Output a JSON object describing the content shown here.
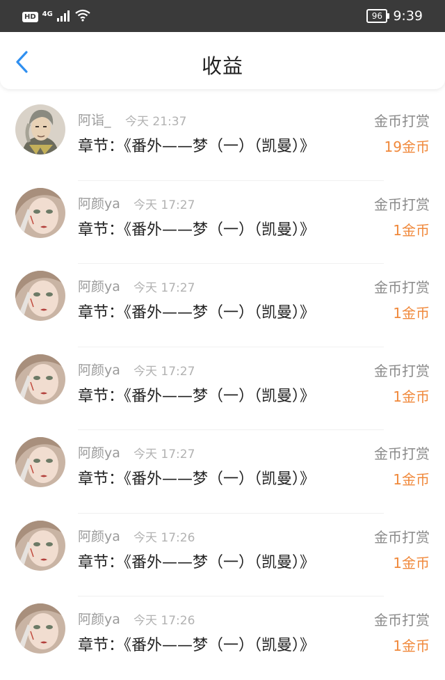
{
  "status_bar": {
    "hd": "HD",
    "network": "4G",
    "battery": "96",
    "time": "9:39"
  },
  "header": {
    "title": "收益"
  },
  "rewards": [
    {
      "name": "阿诣_",
      "time": "今天 21:37",
      "chapter": "章节：《番外——梦（一）（凯曼）》",
      "type": "金币打赏",
      "amount": "19金币"
    },
    {
      "name": "阿颜ya",
      "time": "今天 17:27",
      "chapter": "章节：《番外——梦（一）（凯曼）》",
      "type": "金币打赏",
      "amount": "1金币"
    },
    {
      "name": "阿颜ya",
      "time": "今天 17:27",
      "chapter": "章节：《番外——梦（一）（凯曼）》",
      "type": "金币打赏",
      "amount": "1金币"
    },
    {
      "name": "阿颜ya",
      "time": "今天 17:27",
      "chapter": "章节：《番外——梦（一）（凯曼）》",
      "type": "金币打赏",
      "amount": "1金币"
    },
    {
      "name": "阿颜ya",
      "time": "今天 17:27",
      "chapter": "章节：《番外——梦（一）（凯曼）》",
      "type": "金币打赏",
      "amount": "1金币"
    },
    {
      "name": "阿颜ya",
      "time": "今天 17:26",
      "chapter": "章节：《番外——梦（一）（凯曼）》",
      "type": "金币打赏",
      "amount": "1金币"
    },
    {
      "name": "阿颜ya",
      "time": "今天 17:26",
      "chapter": "章节：《番外——梦（一）（凯曼）》",
      "type": "金币打赏",
      "amount": "1金币"
    }
  ],
  "colors": {
    "accent_blue": "#2f8ff0",
    "amount_orange": "#f0883a",
    "status_bar_bg": "#3a3a3a"
  }
}
